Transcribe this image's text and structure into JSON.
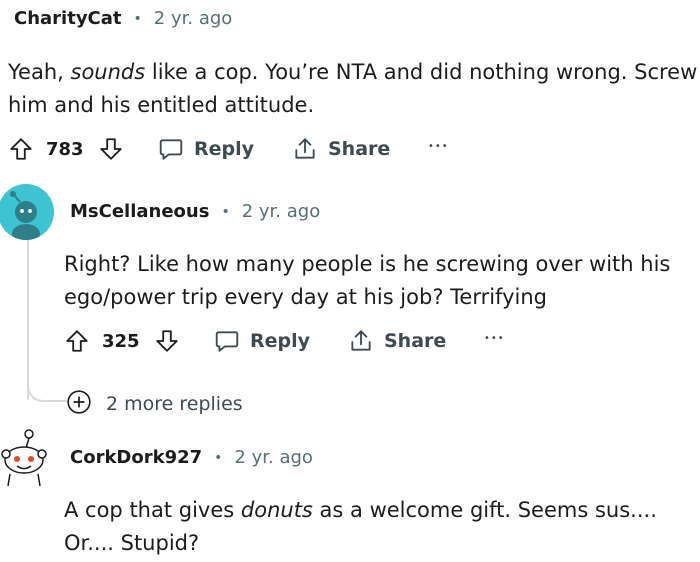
{
  "comments": [
    {
      "username": "CharityCat",
      "time": "2 yr. ago",
      "text_parts": [
        "Yeah, ",
        "sounds",
        " like a cop. You’re NTA and did nothing wrong. Screw him and his entitled attitude."
      ],
      "votes": "783",
      "reply_label": "Reply",
      "share_label": "Share"
    },
    {
      "username": "MsCellaneous",
      "time": "2 yr. ago",
      "text": "Right? Like how many people is he screwing over with his ego/power trip every day at his job? Terrifying",
      "votes": "325",
      "reply_label": "Reply",
      "share_label": "Share",
      "more_replies": "2 more replies"
    },
    {
      "username": "CorkDork927",
      "time": "2 yr. ago",
      "text_parts": [
        "A cop that gives ",
        "donuts",
        " as a welcome gift. Seems sus.... Or.... Stupid?"
      ]
    }
  ],
  "separator": "•",
  "overflow_glyph": "•••",
  "colors": {
    "avatar_teal": "#3ec3d3",
    "avatar_body": "#2e7f8a",
    "meta": "#576f76",
    "line": "#d5dbdc"
  }
}
